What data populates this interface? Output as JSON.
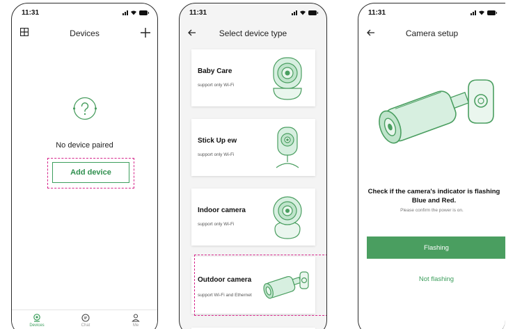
{
  "status_bar": {
    "time": "11:31"
  },
  "screen_devices": {
    "title": "Devices",
    "left_icon": "grid-icon",
    "right_icon": "plus-icon",
    "empty_icon": "question-mark-icon",
    "empty_text": "No device paired",
    "add_button": "Add device",
    "tabs": [
      {
        "label": "Devices",
        "icon": "camera-icon",
        "active": true
      },
      {
        "label": "Chat",
        "icon": "chat-icon",
        "active": false
      },
      {
        "label": "Me",
        "icon": "user-icon",
        "active": false
      }
    ]
  },
  "screen_select": {
    "title": "Select device type",
    "back_icon": "arrow-left-icon",
    "cards": [
      {
        "title": "Baby Care",
        "subtitle": "support only Wi-Fi",
        "icon": "baby-care-camera-icon"
      },
      {
        "title": "Stick Up  ew",
        "subtitle": "support only Wi-Fi",
        "icon": "stick-up-camera-icon"
      },
      {
        "title": "Indoor camera",
        "subtitle": "support only Wi-Fi",
        "icon": "indoor-camera-icon"
      },
      {
        "title": "Outdoor camera",
        "subtitle": "support Wi-Fi and Ethernet",
        "icon": "outdoor-camera-icon",
        "highlighted": true
      }
    ]
  },
  "screen_setup": {
    "title": "Camera setup",
    "back_icon": "arrow-left-icon",
    "illustration": "outdoor-camera-icon",
    "check_title": "Check if the camera's indicator is flashing Blue and Red.",
    "check_sub": "Please confirm the power is on.",
    "primary_button": "Flashing",
    "secondary_button": "Not flashing"
  },
  "colors": {
    "accent": "#3c9e5c",
    "button_fill": "#4a9e60",
    "highlight_dash": "#d6248a"
  }
}
